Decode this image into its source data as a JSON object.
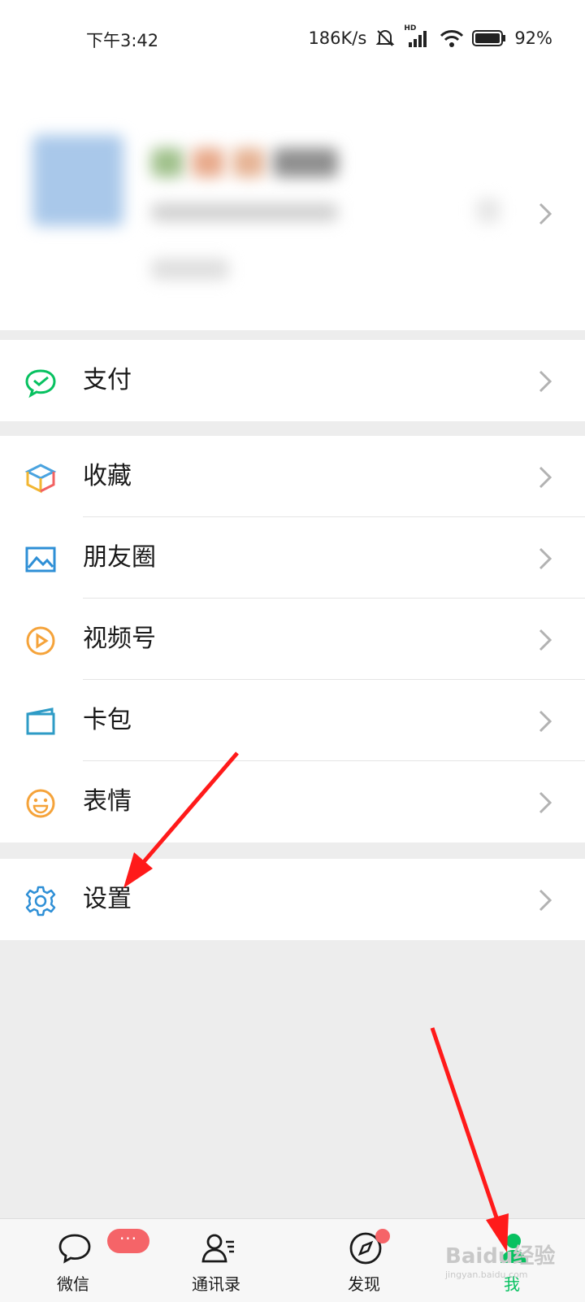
{
  "status": {
    "time": "下午3:42",
    "speed": "186K/s",
    "battery": "92%",
    "hd": "HD"
  },
  "menu": {
    "pay": "支付",
    "favorites": "收藏",
    "moments": "朋友圈",
    "channels": "视频号",
    "cards": "卡包",
    "stickers": "表情",
    "settings": "设置"
  },
  "tabs": {
    "chats": "微信",
    "contacts": "通讯录",
    "discover": "发现",
    "me": "我",
    "chats_badge": "···"
  },
  "watermark": {
    "text": "Baidu经验",
    "sub": "jingyan.baidu.com"
  },
  "colors": {
    "accent": "#07c160",
    "badge": "#f56468",
    "arrow": "#ff1a1a"
  }
}
